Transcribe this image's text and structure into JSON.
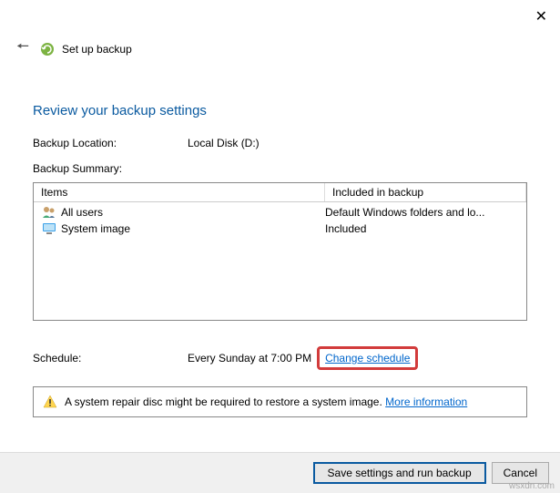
{
  "window": {
    "title": "Set up backup"
  },
  "page": {
    "heading": "Review your backup settings",
    "location_label": "Backup Location:",
    "location_value": "Local Disk (D:)",
    "summary_label": "Backup Summary:"
  },
  "table": {
    "col_items": "Items",
    "col_included": "Included in backup",
    "rows": [
      {
        "icon": "users",
        "name": "All users",
        "included": "Default Windows folders and lo..."
      },
      {
        "icon": "monitor",
        "name": "System image",
        "included": "Included"
      }
    ]
  },
  "schedule": {
    "label": "Schedule:",
    "value": "Every Sunday at 7:00 PM",
    "change_link": "Change schedule"
  },
  "warning": {
    "text": "A system repair disc might be required to restore a system image.",
    "more_info": "More information"
  },
  "buttons": {
    "save": "Save settings and run backup",
    "cancel": "Cancel"
  },
  "watermark": "wsxdn.com"
}
